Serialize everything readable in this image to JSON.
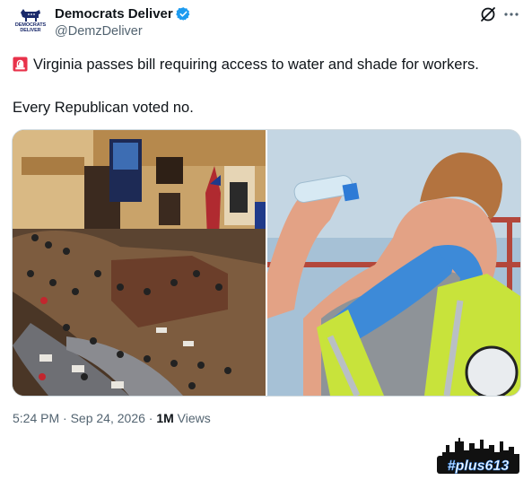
{
  "account": {
    "avatar_text_line1": "DEMOCRATS",
    "avatar_text_line2": "DELIVER",
    "display_name": "Democrats Deliver",
    "handle": "@DemzDeliver",
    "verified_color": "#1d9bf0"
  },
  "actions": {
    "grok_icon": "grok-icon",
    "more_icon": "more-icon"
  },
  "tweet": {
    "line1": "Virginia passes bill requiring access to water and shade for workers.",
    "line2": "Every Republican voted no.",
    "emoji": "rotating-light-icon"
  },
  "media": {
    "left_image": "legislative-chamber-photo",
    "right_image": "worker-drinking-water-photo"
  },
  "meta": {
    "time": "5:24 PM",
    "sep1": " · ",
    "date": "Sep 24, 2026",
    "sep2": " · ",
    "views_count": "1M",
    "views_label": " Views"
  },
  "watermark": {
    "text": "#plus613"
  },
  "colors": {
    "text": "#0f1419",
    "secondary": "#536471",
    "border": "#cfd9de",
    "brand_navy": "#1a2a6b"
  }
}
